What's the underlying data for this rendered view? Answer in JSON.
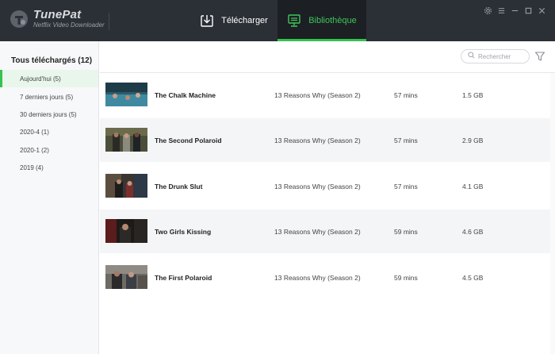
{
  "app": {
    "name": "TunePat",
    "subtitle": "Netflix Video Downloader"
  },
  "nav": {
    "download_label": "Télécharger",
    "library_label": "Bibliothèque"
  },
  "window_controls": [
    "gear-icon",
    "menu-icon",
    "minimize-icon",
    "maximize-icon",
    "close-icon"
  ],
  "sidebar": {
    "title": "Tous téléchargés (12)",
    "items": [
      {
        "label": "Aujourd'hui (5)",
        "active": true
      },
      {
        "label": "7 derniers jours (5)",
        "active": false
      },
      {
        "label": "30 derniers jours (5)",
        "active": false
      },
      {
        "label": "2020-4 (1)",
        "active": false
      },
      {
        "label": "2020-1 (2)",
        "active": false
      },
      {
        "label": "2019 (4)",
        "active": false
      }
    ]
  },
  "search": {
    "placeholder": "Rechercher"
  },
  "rows": [
    {
      "title": "The Chalk Machine",
      "series": "13 Reasons Why (Season 2)",
      "duration": "57 mins",
      "size": "1.5 GB"
    },
    {
      "title": "The Second Polaroid",
      "series": "13 Reasons Why (Season 2)",
      "duration": "57 mins",
      "size": "2.9 GB"
    },
    {
      "title": "The Drunk Slut",
      "series": "13 Reasons Why (Season 2)",
      "duration": "57 mins",
      "size": "4.1 GB"
    },
    {
      "title": "Two Girls Kissing",
      "series": "13 Reasons Why (Season 2)",
      "duration": "59 mins",
      "size": "4.6 GB"
    },
    {
      "title": "The First Polaroid",
      "series": "13 Reasons Why (Season 2)",
      "duration": "59 mins",
      "size": "4.5 GB"
    }
  ],
  "colors": {
    "header_bg": "#2b2f36",
    "accent": "#35c24f",
    "row_alt": "#f4f5f7"
  }
}
